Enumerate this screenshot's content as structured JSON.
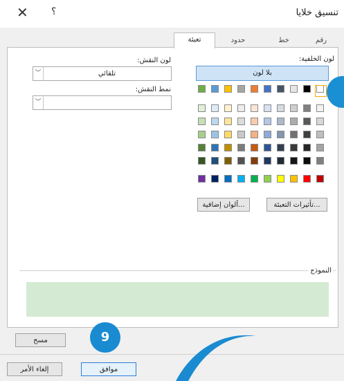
{
  "window": {
    "title": "تنسيق خلايا",
    "help_label": "؟",
    "close_label": "✕"
  },
  "tabs": [
    {
      "label": "رقم",
      "active": false
    },
    {
      "label": "خط",
      "active": false
    },
    {
      "label": "حدود",
      "active": false
    },
    {
      "label": "تعبئة",
      "active": true
    }
  ],
  "fill": {
    "background_color_label": "لون الخلفية:",
    "no_color_label": "بلا لون",
    "fill_effects_label": "تأثيرات التعبئة...",
    "more_colors_label": "ألوان إضافية...",
    "pattern_color_label": "لون النقش:",
    "pattern_color_value": "تلقائي",
    "pattern_style_label": "نمط النقش:",
    "pattern_style_value": "",
    "sample_label": "النموذج",
    "sample_color": "#d5ead2",
    "selected_color": "#d5ead2"
  },
  "palette": {
    "theme_top": [
      "#ffffff",
      "#000000",
      "#e7e6e6",
      "#44546a",
      "#4472c4",
      "#ed7d31",
      "#a5a5a5",
      "#ffc000",
      "#5b9bd5",
      "#70ad47"
    ],
    "theme_rows": [
      [
        "#f2f2f2",
        "#808080",
        "#d0cece",
        "#d6dce4",
        "#d9e2f3",
        "#fbe5d5",
        "#ededed",
        "#fff2cc",
        "#deebf6",
        "#e2efd9"
      ],
      [
        "#d8d8d8",
        "#595959",
        "#aeabab",
        "#adb9ca",
        "#b4c6e7",
        "#f7cbac",
        "#dbdbdb",
        "#fee599",
        "#bdd7ee",
        "#c5e0b3"
      ],
      [
        "#bfbfbf",
        "#3f3f3f",
        "#757070",
        "#8496b0",
        "#8eaadb",
        "#f4b183",
        "#c9c9c9",
        "#ffd965",
        "#9cc3e5",
        "#a8d08d"
      ],
      [
        "#a5a5a5",
        "#262626",
        "#3a3838",
        "#323f4f",
        "#2f5496",
        "#c55a11",
        "#7b7b7b",
        "#bf8f00",
        "#2e75b5",
        "#538135"
      ],
      [
        "#7f7f7f",
        "#0c0c0c",
        "#171616",
        "#222a35",
        "#1f3864",
        "#833c0b",
        "#525252",
        "#7f6000",
        "#1e4e79",
        "#375623"
      ]
    ],
    "standard": [
      "#c00000",
      "#ff0000",
      "#ffc000",
      "#ffff00",
      "#92d050",
      "#00b050",
      "#00b0f0",
      "#0070c0",
      "#002060",
      "#7030a0"
    ]
  },
  "buttons": {
    "clear_label": "مسح",
    "ok_label": "موافق",
    "cancel_label": "إلغاء الأمر"
  },
  "annotation": {
    "step_number": "9",
    "accent_color": "#1a8bd1"
  }
}
